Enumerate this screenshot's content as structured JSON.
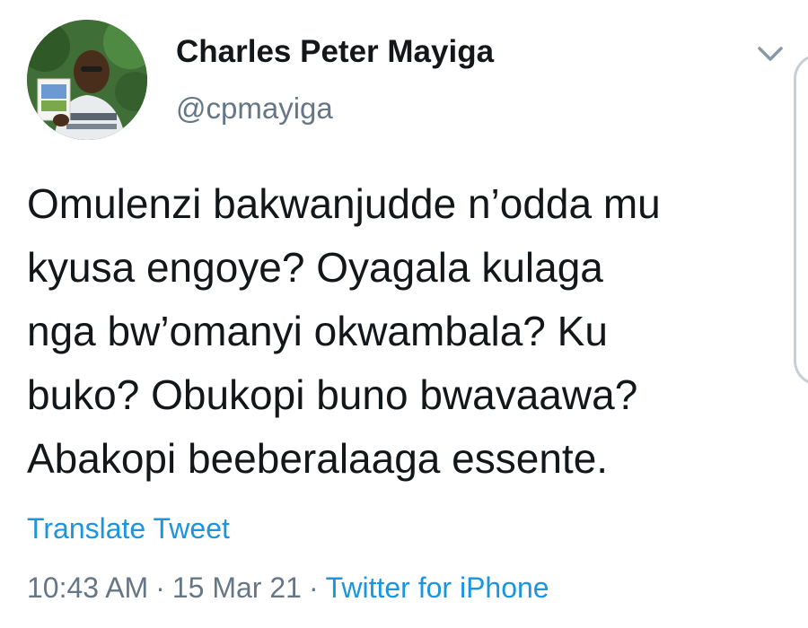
{
  "author": {
    "display_name": "Charles Peter Mayiga",
    "handle": "@cpmayiga",
    "avatar_icon": "profile-photo-avatar"
  },
  "header": {
    "menu_icon": "chevron-down-icon"
  },
  "tweet": {
    "text": "Omulenzi bakwanjudde n’odda mu\nkyusa engoye? Oyagala kulaga\nnga bw’omanyi okwambala? Ku\nbuko? Obukopi buno bwavaawa?\nAbakopi beeberalaaga essente."
  },
  "translate": {
    "label": "Translate Tweet"
  },
  "meta": {
    "time": "10:43 AM",
    "separator": "·",
    "date": "15 Mar 21",
    "source": "Twitter for iPhone"
  },
  "colors": {
    "text": "#14171a",
    "secondary": "#657786",
    "link": "#1b95e0",
    "background": "#ffffff"
  }
}
